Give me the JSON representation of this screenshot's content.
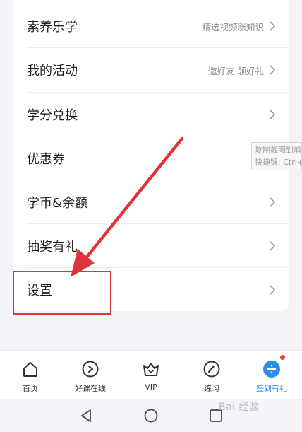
{
  "menu": {
    "items": [
      {
        "label": "素养乐学",
        "sub": "精选视频涨知识"
      },
      {
        "label": "我的活动",
        "sub": "邀好友 领好礼"
      },
      {
        "label": "学分兑换",
        "sub": ""
      },
      {
        "label": "优惠券",
        "sub": ""
      },
      {
        "label": "学币&余额",
        "sub": ""
      },
      {
        "label": "抽奖有礼",
        "sub": ""
      },
      {
        "label": "设置",
        "sub": ""
      }
    ]
  },
  "tooltip": {
    "line1": "复制截图到剪",
    "line2": "快捷键: Ctrl+"
  },
  "tabbar": {
    "tabs": [
      {
        "label": "首页",
        "icon": "home-icon"
      },
      {
        "label": "好课在线",
        "icon": "play-icon"
      },
      {
        "label": "VIP",
        "icon": "vip-crown-icon"
      },
      {
        "label": "练习",
        "icon": "pen-icon"
      },
      {
        "label": "签到有礼",
        "icon": "checkin-icon"
      }
    ]
  },
  "watermark": {
    "text": "Bai 经验"
  },
  "colors": {
    "accent": "#2b8fe8",
    "annotation_red": "#e0343a"
  }
}
